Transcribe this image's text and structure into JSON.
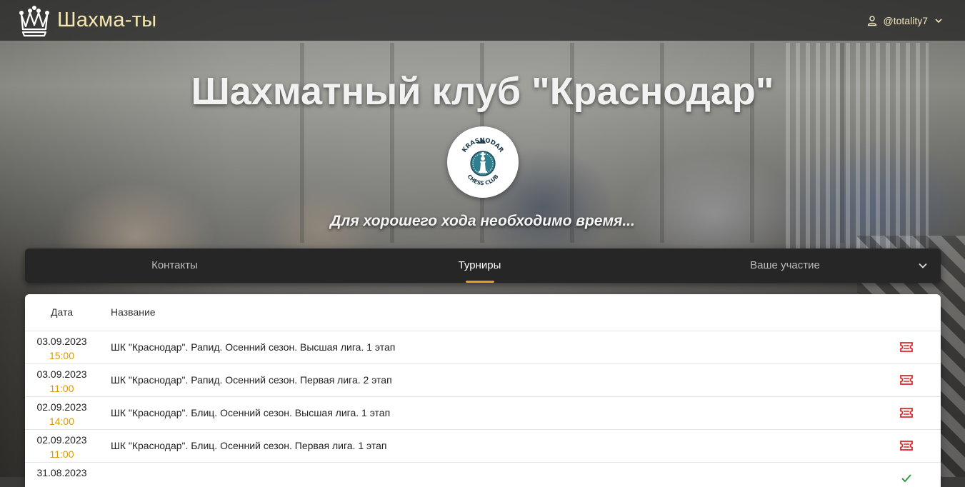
{
  "header": {
    "brand_name": "Шахма-ты",
    "user_handle": "@totality7"
  },
  "hero": {
    "title": "Шахматный клуб \"Краснодар\"",
    "logo_text_top": "KRASNODAR",
    "logo_text_bottom": "CHESS CLUB",
    "tagline": "Для хорошего хода необходимо время..."
  },
  "tabs": [
    {
      "label": "Контакты",
      "active": false
    },
    {
      "label": "Турниры",
      "active": true
    },
    {
      "label": "Ваше участие",
      "active": false
    }
  ],
  "table": {
    "columns": [
      "Дата",
      "Название"
    ],
    "rows": [
      {
        "date": "03.09.2023",
        "time": "15:00",
        "name": "ШК \"Краснодар\". Рапид. Осенний сезон. Высшая лига. 1 этап",
        "action_icon": "ticket-icon"
      },
      {
        "date": "03.09.2023",
        "time": "11:00",
        "name": "ШК \"Краснодар\". Рапид. Осенний сезон. Первая лига. 2 этап",
        "action_icon": "ticket-icon"
      },
      {
        "date": "02.09.2023",
        "time": "14:00",
        "name": "ШК \"Краснодар\". Блиц. Осенний сезон. Высшая лига. 1 этап",
        "action_icon": "ticket-icon"
      },
      {
        "date": "02.09.2023",
        "time": "11:00",
        "name": "ШК \"Краснодар\". Блиц. Осенний сезон. Первая лига. 1 этап",
        "action_icon": "ticket-icon"
      },
      {
        "date": "31.08.2023",
        "time": "",
        "name": "",
        "action_icon": "check-icon"
      }
    ]
  },
  "colors": {
    "accent": "#e0a21c",
    "time": "#d99a00",
    "ticket": "#e0262a",
    "brand_text": "#f5e7b0",
    "tabs_bg": "#262626"
  }
}
